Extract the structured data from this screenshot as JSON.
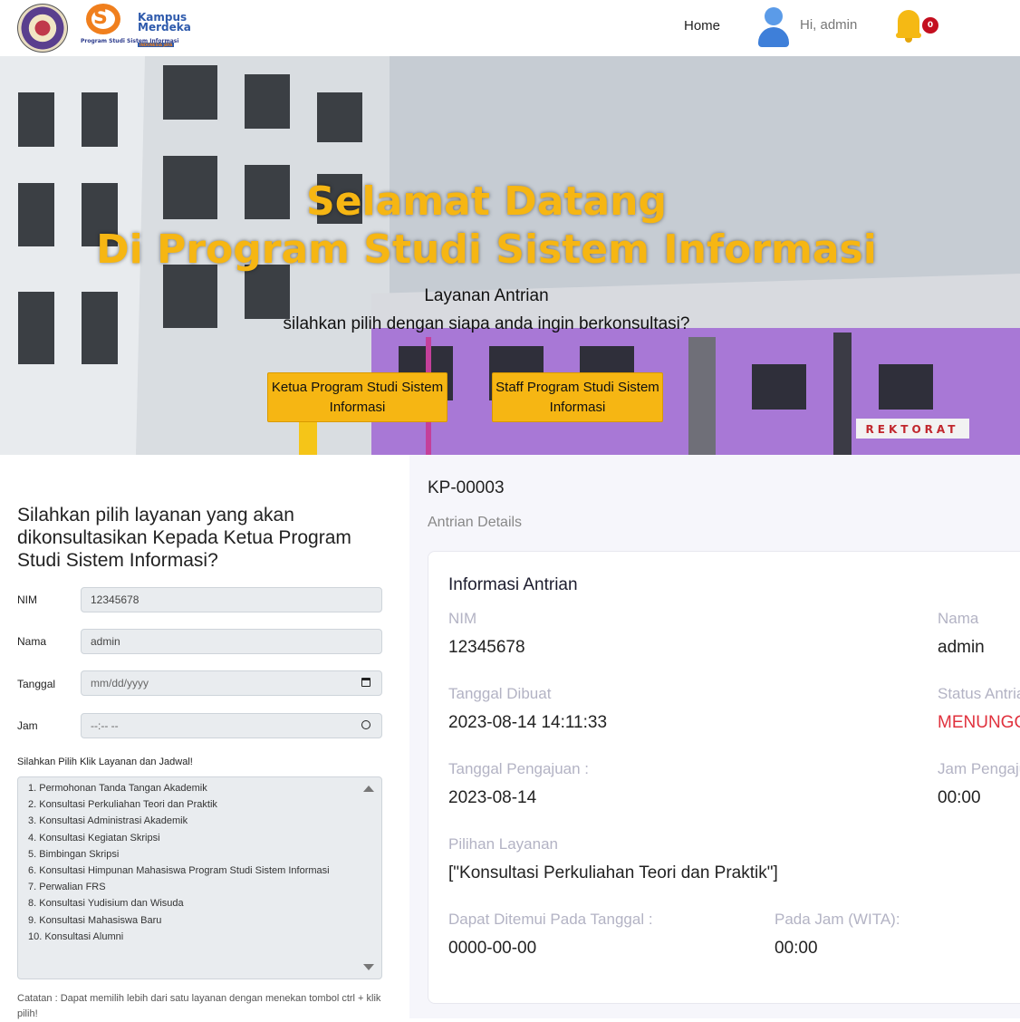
{
  "navbar": {
    "logo2_text": "Program Studi Sistem Informasi",
    "logo3_line1": "Kampus",
    "logo3_line2": "Merdeka",
    "logo3_line3": "INDONESIA JAYA",
    "home_label": "Home",
    "greeting": "Hi, admin",
    "notification_count": "0"
  },
  "hero": {
    "title_line1": "Selamat Datang",
    "title_line2": "Di Program Studi Sistem Informasi",
    "subtitle_line1": "Layanan Antrian",
    "subtitle_line2": "silahkan pilih dengan siapa anda ingin berkonsultasi?",
    "button_ketua": "Ketua Program Studi Sistem Informasi",
    "button_staff": "Staff Program Studi Sistem Informasi",
    "building_sign": "REKTORAT"
  },
  "form": {
    "heading": "Silahkan pilih layanan yang akan dikonsultasikan Kepada Ketua Program Studi Sistem Informasi?",
    "nim_label": "NIM",
    "nim_value": "12345678",
    "nama_label": "Nama",
    "nama_value": "admin",
    "tanggal_label": "Tanggal",
    "tanggal_placeholder": "mm/dd/yyyy",
    "jam_label": "Jam",
    "jam_placeholder": "--:-- --",
    "layanan_label": "Silahkan Pilih Klik Layanan dan Jadwal!",
    "layanan_options": [
      "1. Permohonan Tanda Tangan Akademik",
      "2. Konsultasi Perkuliahan Teori dan Praktik",
      "3. Konsultasi Administrasi Akademik",
      "4. Konsultasi Kegiatan Skripsi",
      "5. Bimbingan Skripsi",
      "6. Konsultasi Himpunan Mahasiswa Program Studi Sistem Informasi",
      "7. Perwalian FRS",
      "8. Konsultasi Yudisium dan Wisuda",
      "9. Konsultasi Mahasiswa Baru",
      "10. Konsultasi Alumni"
    ],
    "note": "Catatan : Dapat memilih lebih dari satu layanan dengan menekan tombol ctrl + klik pilih!"
  },
  "detail": {
    "kode": "KP-00003",
    "subtitle": "Antrian Details",
    "card_title": "Informasi Antrian",
    "nim_label": "NIM",
    "nim_value": "12345678",
    "nama_label": "Nama",
    "nama_value": "admin",
    "tanggal_dibuat_label": "Tanggal Dibuat",
    "tanggal_dibuat_value": "2023-08-14 14:11:33",
    "status_label": "Status Antrian",
    "status_value": "MENUNGGU",
    "status_color": "#e0313d",
    "tanggal_pengajuan_label": "Tanggal Pengajuan :",
    "tanggal_pengajuan_value": "2023-08-14",
    "jam_pengajuan_label": "Jam Pengajuan",
    "jam_pengajuan_value": "00:00",
    "pilihan_layanan_label": "Pilihan Layanan",
    "pilihan_layanan_value": "[\"Konsultasi Perkuliahan Teori dan Praktik\"]",
    "ditemui_tanggal_label": "Dapat Ditemui Pada Tanggal :",
    "ditemui_tanggal_value": "0000-00-00",
    "ditemui_jam_label": "Pada Jam (WITA):",
    "ditemui_jam_value": "00:00"
  },
  "colors": {
    "accent": "#f6b613",
    "badge": "#c40f1f",
    "building": "#a878d6"
  }
}
